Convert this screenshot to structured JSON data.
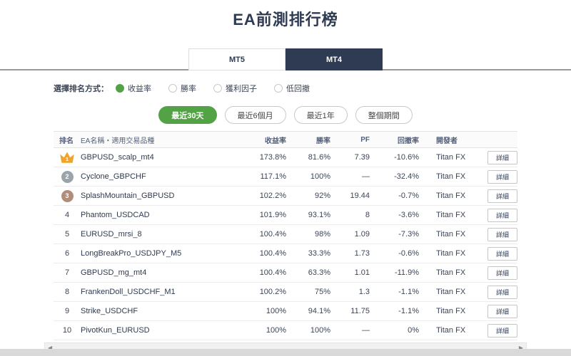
{
  "page": {
    "title": "EA前測排行榜"
  },
  "tabs": [
    {
      "label": "MT5",
      "active": false
    },
    {
      "label": "MT4",
      "active": true
    }
  ],
  "rank_selector": {
    "label": "選擇排名方式：",
    "options": [
      {
        "label": "收益率",
        "selected": true
      },
      {
        "label": "勝率",
        "selected": false
      },
      {
        "label": "獲利因子",
        "selected": false
      },
      {
        "label": "低回撤",
        "selected": false
      }
    ]
  },
  "period_filters": [
    {
      "label": "最近30天",
      "active": true
    },
    {
      "label": "最近6個月",
      "active": false
    },
    {
      "label": "最近1年",
      "active": false
    },
    {
      "label": "整個期間",
      "active": false
    }
  ],
  "table": {
    "headers": {
      "rank": "排名",
      "name": "EA名稱・適用交易品種",
      "return": "收益率",
      "win": "勝率",
      "pf": "PF",
      "drawdown": "回撤率",
      "developer": "開發者"
    },
    "detail_label": "詳細",
    "rows": [
      {
        "rank": "1",
        "rank_style": "crown",
        "name": "GBPUSD_scalp_mt4",
        "return": "173.8%",
        "win": "81.6%",
        "pf": "7.39",
        "drawdown": "-10.6%",
        "developer": "Titan FX"
      },
      {
        "rank": "2",
        "rank_style": "silver",
        "name": "Cyclone_GBPCHF",
        "return": "117.1%",
        "win": "100%",
        "pf": "—",
        "drawdown": "-32.4%",
        "developer": "Titan FX"
      },
      {
        "rank": "3",
        "rank_style": "bronze",
        "name": "SplashMountain_GBPUSD",
        "return": "102.2%",
        "win": "92%",
        "pf": "19.44",
        "drawdown": "-0.7%",
        "developer": "Titan FX"
      },
      {
        "rank": "4",
        "rank_style": "plain",
        "name": "Phantom_USDCAD",
        "return": "101.9%",
        "win": "93.1%",
        "pf": "8",
        "drawdown": "-3.6%",
        "developer": "Titan FX"
      },
      {
        "rank": "5",
        "rank_style": "plain",
        "name": "EURUSD_mrsi_8",
        "return": "100.4%",
        "win": "98%",
        "pf": "1.09",
        "drawdown": "-7.3%",
        "developer": "Titan FX"
      },
      {
        "rank": "6",
        "rank_style": "plain",
        "name": "LongBreakPro_USDJPY_M5",
        "return": "100.4%",
        "win": "33.3%",
        "pf": "1.73",
        "drawdown": "-0.6%",
        "developer": "Titan FX"
      },
      {
        "rank": "7",
        "rank_style": "plain",
        "name": "GBPUSD_mg_mt4",
        "return": "100.4%",
        "win": "63.3%",
        "pf": "1.01",
        "drawdown": "-11.9%",
        "developer": "Titan FX"
      },
      {
        "rank": "8",
        "rank_style": "plain",
        "name": "FrankenDoll_USDCHF_M1",
        "return": "100.2%",
        "win": "75%",
        "pf": "1.3",
        "drawdown": "-1.1%",
        "developer": "Titan FX"
      },
      {
        "rank": "9",
        "rank_style": "plain",
        "name": "Strike_USDCHF",
        "return": "100%",
        "win": "94.1%",
        "pf": "11.75",
        "drawdown": "-1.1%",
        "developer": "Titan FX"
      },
      {
        "rank": "10",
        "rank_style": "plain",
        "name": "PivotKun_EURUSD",
        "return": "100%",
        "win": "100%",
        "pf": "—",
        "drawdown": "0%",
        "developer": "Titan FX"
      }
    ]
  },
  "scrollbar": {
    "left_arrow": "◀",
    "right_arrow": "▶"
  },
  "colors": {
    "accent_green": "#53a245",
    "navy": "#2e3b52",
    "gold": "#efa32b",
    "silver": "#9aa4ab",
    "bronze": "#b18d7c"
  }
}
